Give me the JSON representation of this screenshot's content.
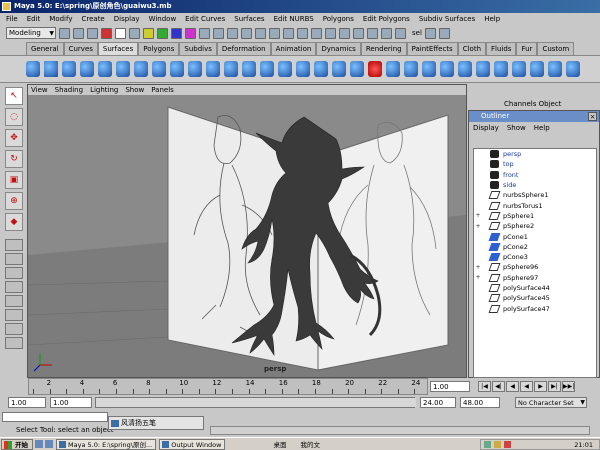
{
  "window": {
    "title": "Maya 5.0: E:\\spring\\原创角色\\guaiwu3.mb"
  },
  "menubar": {
    "items": [
      "File",
      "Edit",
      "Modify",
      "Create",
      "Display",
      "Window",
      "Edit Curves",
      "Surfaces",
      "Edit NURBS",
      "Polygons",
      "Edit Polygons",
      "Subdiv Surfaces",
      "Help"
    ]
  },
  "statusline": {
    "mode": "Modeling",
    "select_label": "sel"
  },
  "shelf": {
    "tabs": [
      "General",
      "Curves",
      "Surfaces",
      "Polygons",
      "Subdivs",
      "Deformation",
      "Animation",
      "Dynamics",
      "Rendering",
      "PaintEffects",
      "Cloth",
      "Fluids",
      "Fur",
      "Custom"
    ],
    "active_tab": "Surfaces"
  },
  "viewport": {
    "menu": [
      "View",
      "Shading",
      "Lighting",
      "Show",
      "Panels"
    ],
    "camera_label": "persp"
  },
  "channelbox": {
    "header": "Channels  Object"
  },
  "outliner": {
    "title": "Outliner",
    "menu": [
      "Display",
      "Show",
      "Help"
    ],
    "items": [
      {
        "label": "persp",
        "icon": "camera-icon",
        "expand": ""
      },
      {
        "label": "top",
        "icon": "camera-icon",
        "expand": ""
      },
      {
        "label": "front",
        "icon": "camera-icon",
        "expand": ""
      },
      {
        "label": "side",
        "icon": "camera-icon",
        "expand": ""
      },
      {
        "label": "nurbsSphere1",
        "icon": "transform-icon",
        "expand": ""
      },
      {
        "label": "nurbsTorus1",
        "icon": "transform-icon",
        "expand": ""
      },
      {
        "label": "pSphere1",
        "icon": "transform-icon",
        "expand": "+"
      },
      {
        "label": "pSphere2",
        "icon": "transform-icon",
        "expand": "+"
      },
      {
        "label": "pCone1",
        "icon": "mesh-icon",
        "expand": ""
      },
      {
        "label": "pCone2",
        "icon": "mesh-icon",
        "expand": ""
      },
      {
        "label": "pCone3",
        "icon": "mesh-icon",
        "expand": ""
      },
      {
        "label": "pSphere96",
        "icon": "transform-icon",
        "expand": "+"
      },
      {
        "label": "pSphere97",
        "icon": "transform-icon",
        "expand": "+"
      },
      {
        "label": "polySurface44",
        "icon": "transform-icon",
        "expand": ""
      },
      {
        "label": "polySurface45",
        "icon": "transform-icon",
        "expand": ""
      },
      {
        "label": "polySurface47",
        "icon": "transform-icon",
        "expand": ""
      }
    ]
  },
  "timeline": {
    "ticks": [
      2,
      4,
      6,
      8,
      10,
      12,
      14,
      16,
      18,
      20,
      22,
      24
    ],
    "range_start": 1,
    "range_end": 24,
    "current_time": "1.00",
    "playback_buttons": [
      "|◀",
      "◀|",
      "◀",
      "◀",
      "▶",
      "▶|",
      "▶▶|"
    ]
  },
  "rangebar": {
    "start_time": "1.00",
    "playback_start": "1.00",
    "playback_end": "24.00",
    "end_time": "48.00",
    "character_set": "No Character Set"
  },
  "ime": {
    "label": "风清扬五笔"
  },
  "helpline": {
    "text": "Select Tool: select an object"
  },
  "taskbar": {
    "start_label": "开始",
    "tasks": [
      "Maya 5.0: E:\\spring\\原创...",
      "Output Window"
    ],
    "tray_label": "桌面",
    "tray_doc": "我的文",
    "clock": "21:01"
  },
  "colors": {
    "title_bar": "#0a246a",
    "outliner_title": "#6a8fc8",
    "ui_gray": "#c8c8c8",
    "viewport_bg": "#8a8a8a"
  }
}
